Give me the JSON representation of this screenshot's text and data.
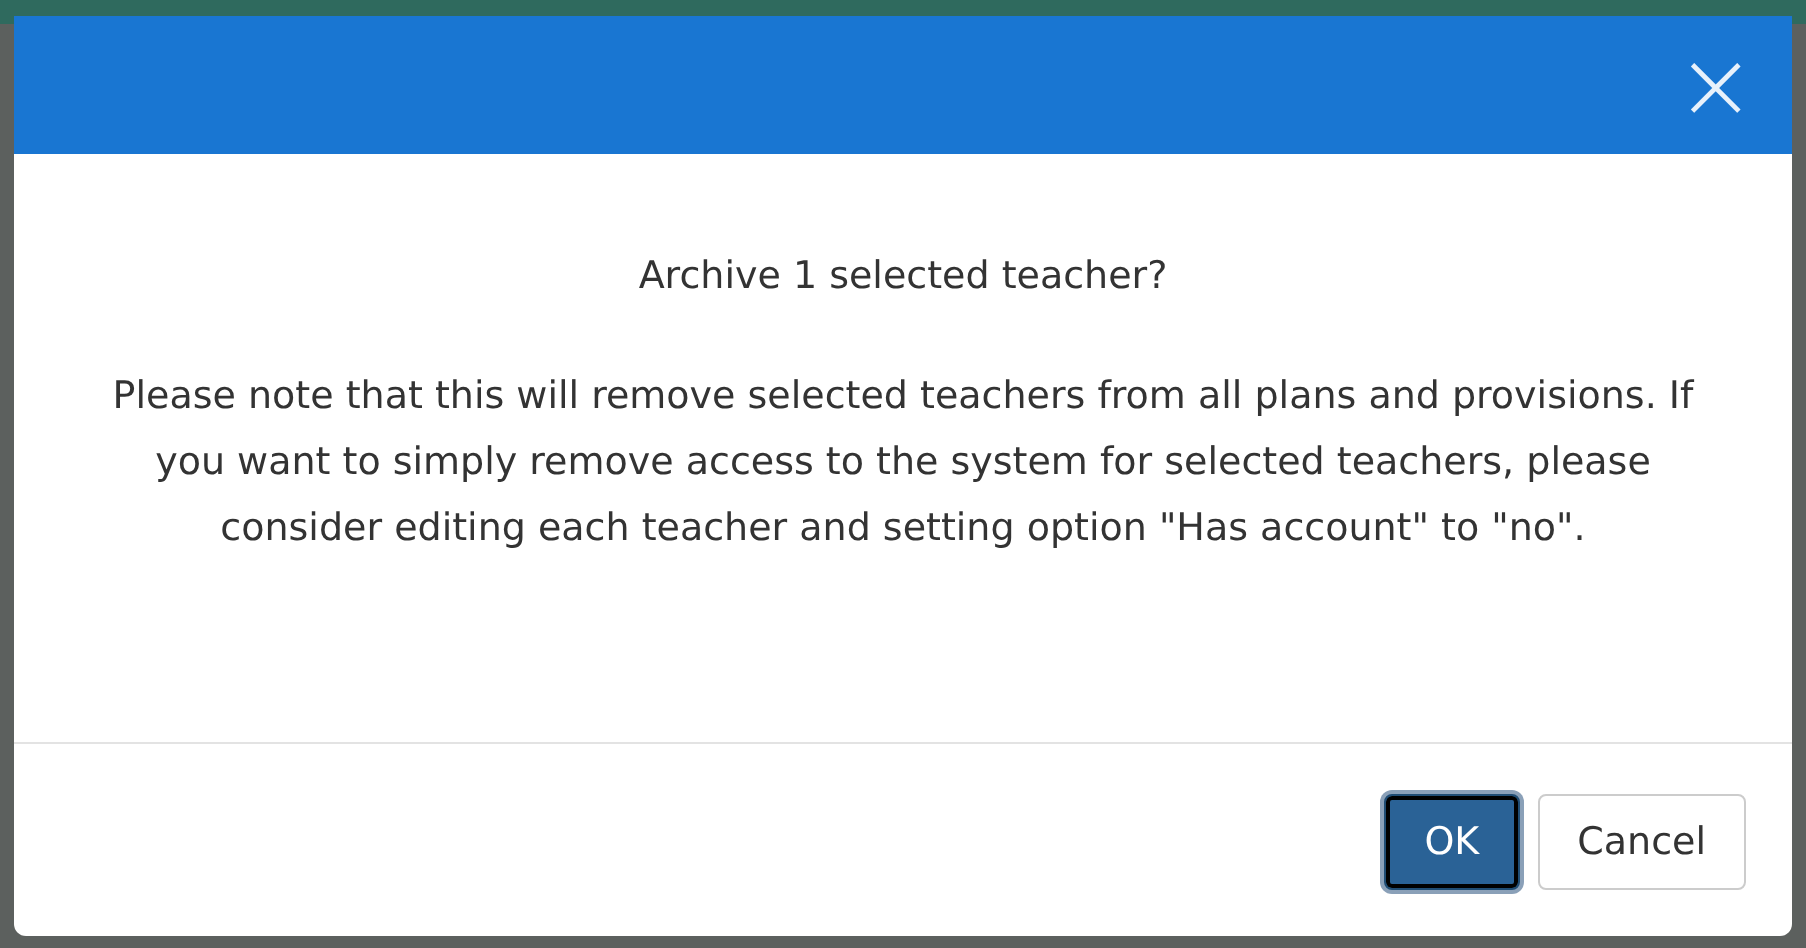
{
  "dialog": {
    "close_label": "×",
    "question": "Archive 1 selected teacher?",
    "message": "Please note that this will remove selected teachers from all plans and provisions. If you want to simply remove access to the system for selected teachers, please consider editing each teacher and setting option \"Has account\" to \"no\".",
    "buttons": [
      {
        "label": "OK",
        "kind": "primary",
        "selected": true
      },
      {
        "label": "Cancel",
        "kind": "secondary",
        "selected": false
      }
    ]
  }
}
